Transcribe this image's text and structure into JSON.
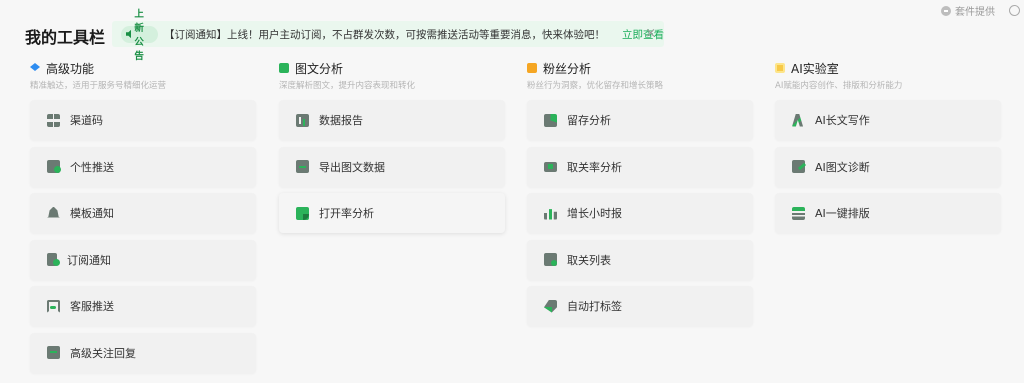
{
  "header": {
    "title": "我的工具栏",
    "provider": "套件提供"
  },
  "notice": {
    "tag": "上新公告",
    "message": "【订阅通知】上线！用户主动订阅，不占群发次数，可按需推送活动等重要消息，快来体验吧！",
    "link": "立即查看",
    "close": "×"
  },
  "columns": [
    {
      "title": "高级功能",
      "desc": "精准触达，适用于服务号精细化运营",
      "icon": "layers-icon",
      "items": [
        {
          "label": "渠道码",
          "icon": "qrcode-icon"
        },
        {
          "label": "个性推送",
          "icon": "card-icon"
        },
        {
          "label": "模板通知",
          "icon": "bell-icon"
        },
        {
          "label": "订阅通知",
          "icon": "doc-icon"
        },
        {
          "label": "客服推送",
          "icon": "headset-icon"
        },
        {
          "label": "高级关注回复",
          "icon": "chat-bubble-icon"
        }
      ]
    },
    {
      "title": "图文分析",
      "desc": "深度解析图文，提升内容表现和转化",
      "icon": "chart-icon",
      "items": [
        {
          "label": "数据报告",
          "icon": "report-icon"
        },
        {
          "label": "导出图文数据",
          "icon": "export-icon"
        },
        {
          "label": "打开率分析",
          "icon": "open-rate-icon"
        }
      ]
    },
    {
      "title": "粉丝分析",
      "desc": "粉丝行为洞察，优化留存和增长策略",
      "icon": "fans-icon",
      "items": [
        {
          "label": "留存分析",
          "icon": "pie-icon"
        },
        {
          "label": "取关率分析",
          "icon": "monitor-icon"
        },
        {
          "label": "增长小时报",
          "icon": "bars-icon"
        },
        {
          "label": "取关列表",
          "icon": "user-icon"
        },
        {
          "label": "自动打标签",
          "icon": "tag-icon"
        }
      ]
    },
    {
      "title": "AI实验室",
      "desc": "AI赋能内容创作、排版和分析能力",
      "icon": "ai-lab-icon",
      "items": [
        {
          "label": "AI长文写作",
          "icon": "ai-write-icon"
        },
        {
          "label": "AI图文诊断",
          "icon": "ai-diagnose-icon"
        },
        {
          "label": "AI一键排版",
          "icon": "ai-layout-icon"
        }
      ]
    }
  ],
  "colors": {
    "accent": "#1aad5a",
    "notice_bg": "#eaf7ee",
    "card_bg": "#f1f1f1"
  }
}
